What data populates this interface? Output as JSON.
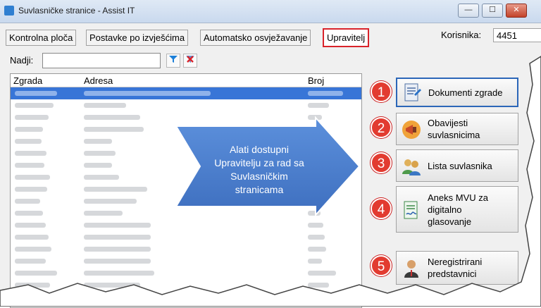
{
  "window": {
    "title": "Suvlasničke stranice - Assist IT",
    "minimize": "—",
    "maximize": "☐",
    "close": "✕"
  },
  "tabs": [
    {
      "label": "Kontrolna ploča"
    },
    {
      "label": "Postavke po izvješćima"
    },
    {
      "label": "Automatsko osvježavanje"
    },
    {
      "label": "Upravitelj",
      "active": true
    }
  ],
  "user": {
    "label": "Korisnika:",
    "value": "4451"
  },
  "search": {
    "label": "Nadji:",
    "value": "",
    "filter_icon": "filter-icon",
    "clear_icon": "clear-filter-icon"
  },
  "grid": {
    "columns": [
      "Zgrada",
      "Adresa",
      "Broj"
    ]
  },
  "callout": {
    "text": [
      "Alati dostupni",
      "Upravitelju za rad sa",
      "Suvlasničkim",
      "stranicama"
    ]
  },
  "side_buttons": [
    {
      "number": "1",
      "label": [
        "Dokumenti zgrade"
      ],
      "icon": "document-icon"
    },
    {
      "number": "2",
      "label": [
        "Obavijesti",
        "suvlasnicima"
      ],
      "icon": "megaphone-icon"
    },
    {
      "number": "3",
      "label": [
        "Lista suvlasnika"
      ],
      "icon": "users-icon"
    },
    {
      "number": "4",
      "label": [
        "Aneks MVU za",
        "digitalno",
        "glasovanje"
      ],
      "icon": "signed-document-icon"
    },
    {
      "number": "5",
      "label": [
        "Neregistrirani",
        "predstavnici"
      ],
      "icon": "person-icon"
    }
  ],
  "colors": {
    "accent_red": "#e23b30",
    "arrow_blue": "#4a7fcf",
    "selection": "#3875d7"
  }
}
